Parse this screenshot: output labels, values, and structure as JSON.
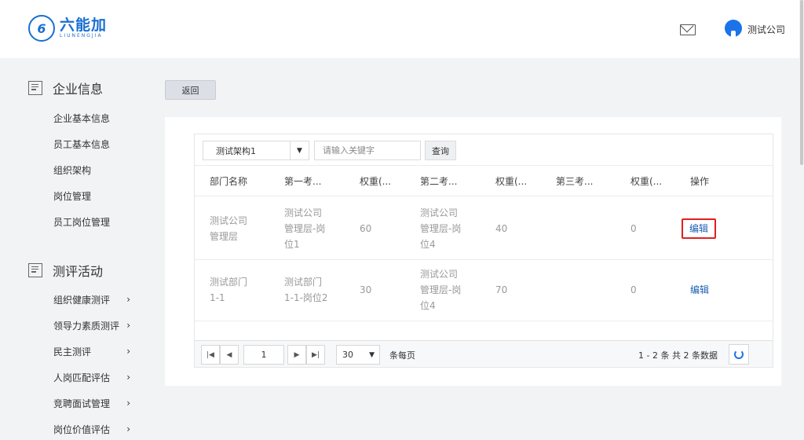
{
  "header": {
    "logo_icon": "6",
    "logo_text": "六能加",
    "logo_sub": "LIUNENGJIA",
    "mail_icon": "mail-icon",
    "user_icon": "user-avatar-icon",
    "user_name": "测试公司"
  },
  "sidebar": {
    "sections": [
      {
        "title": "企业信息",
        "icon": "building-icon",
        "items": [
          {
            "label": "企业基本信息"
          },
          {
            "label": "员工基本信息"
          },
          {
            "label": "组织架构"
          },
          {
            "label": "岗位管理"
          },
          {
            "label": "员工岗位管理"
          }
        ]
      },
      {
        "title": "测评活动",
        "icon": "clipboard-icon",
        "items": [
          {
            "label": "组织健康测评",
            "chevron": "›"
          },
          {
            "label": "领导力素质测评",
            "chevron": "›"
          },
          {
            "label": "民主测评",
            "chevron": "›"
          },
          {
            "label": "人岗匹配评估",
            "chevron": "›"
          },
          {
            "label": "竞聘面试管理",
            "chevron": "›"
          },
          {
            "label": "岗位价值评估",
            "chevron": "›"
          }
        ]
      }
    ]
  },
  "main": {
    "back_label": "返回",
    "toolbar": {
      "select_value": "测试架构1",
      "select_arrow": "▼",
      "search_placeholder": "请输入关键字",
      "query_label": "查询"
    },
    "columns": [
      "部门名称",
      "第一考...",
      "权重(...",
      "第二考...",
      "权重(...",
      "第三考...",
      "权重(...",
      "操作"
    ],
    "rows": [
      {
        "dept": [
          "测试公司",
          "管理层"
        ],
        "first": [
          "测试公司",
          "管理层-岗",
          "位1"
        ],
        "w1": "60",
        "second": [
          "测试公司",
          "管理层-岗",
          "位4"
        ],
        "w2": "40",
        "third": "",
        "w3": "0",
        "action": "编辑",
        "action_highlighted": true
      },
      {
        "dept": [
          "测试部门",
          "1-1"
        ],
        "first": [
          "测试部门",
          "1-1-岗位2"
        ],
        "w1": "30",
        "second": [
          "测试公司",
          "管理层-岗",
          "位4"
        ],
        "w2": "70",
        "third": "",
        "w3": "0",
        "action": "编辑",
        "action_highlighted": false
      }
    ],
    "pager": {
      "first_icon": "|◀",
      "prev_icon": "◀",
      "page": "1",
      "next_icon": "▶",
      "last_icon": "▶|",
      "page_size": "30",
      "page_size_arrow": "▼",
      "page_size_label": "条每页",
      "summary": "1 - 2 条   共 2 条数据",
      "refresh_icon": "refresh-icon"
    },
    "colors": {
      "brand": "#1a6fd1",
      "link": "#1a5fb4",
      "highlight": "#e02020"
    }
  }
}
